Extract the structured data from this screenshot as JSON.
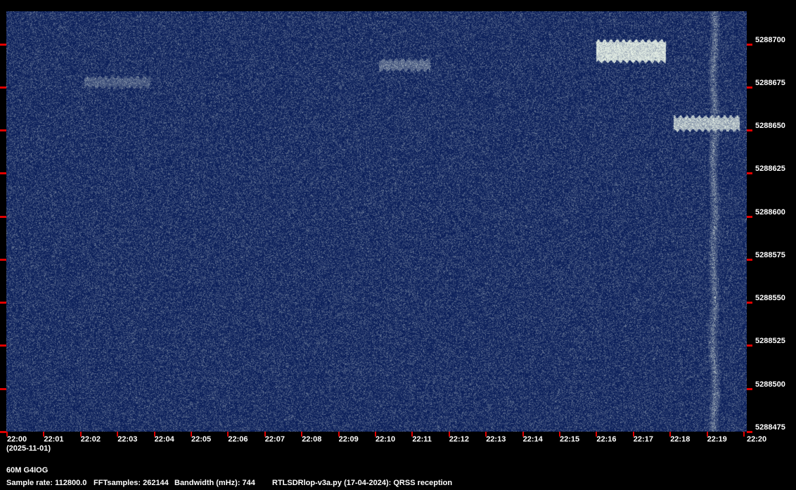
{
  "chart_data": {
    "type": "heatmap",
    "subtype": "spectrogram",
    "x_start_label": "22:00",
    "x_tick_labels": [
      "22:00",
      "22:01",
      "22:02",
      "22:03",
      "22:04",
      "22:05",
      "22:06",
      "22:07",
      "22:08",
      "22:09",
      "22:10",
      "22:11",
      "22:12",
      "22:13",
      "22:14",
      "22:15",
      "22:16",
      "22:17",
      "22:18",
      "22:19",
      "22:20"
    ],
    "xlim_minutes": [
      0,
      20
    ],
    "date_label": "(2025-11-01)",
    "y_tick_labels": [
      "5288700",
      "5288675",
      "5288650",
      "5288625",
      "5288600",
      "5288575",
      "5288550",
      "5288525",
      "5288500",
      "5288475"
    ],
    "y_ticks": [
      5288700,
      5288675,
      5288650,
      5288625,
      5288600,
      5288575,
      5288550,
      5288525,
      5288500,
      5288475
    ],
    "ylim_hz": [
      5288475,
      5288719
    ],
    "colormap": {
      "low": "#0a1e5a",
      "high": "#e8e8e8"
    },
    "signals": [
      {
        "kind": "band",
        "t_start_min": 2.1,
        "t_end_min": 3.9,
        "freq_hz": 5288678,
        "width_hz": 3,
        "intensity": 0.25
      },
      {
        "kind": "band",
        "t_start_min": 10.1,
        "t_end_min": 11.5,
        "freq_hz": 5288688,
        "width_hz": 3,
        "intensity": 0.35
      },
      {
        "kind": "band",
        "t_start_min": 16.0,
        "t_end_min": 17.9,
        "freq_hz": 5288696,
        "width_hz": 6,
        "intensity": 1.0
      },
      {
        "kind": "band",
        "t_start_min": 18.1,
        "t_end_min": 19.9,
        "freq_hz": 5288654,
        "width_hz": 4,
        "intensity": 0.8
      },
      {
        "kind": "vertical",
        "t_min": 19.2,
        "width_min": 0.15,
        "intensity": 0.6
      }
    ]
  },
  "footer": {
    "station": "60M G4IOG",
    "sample_rate": "Sample rate: 112800.0",
    "fft_samples": "FFTsamples: 262144",
    "bandwidth": "Bandwidth (mHz): 744",
    "software": "RTLSDRlop-v3a.py (17-04-2024): QRSS reception"
  }
}
